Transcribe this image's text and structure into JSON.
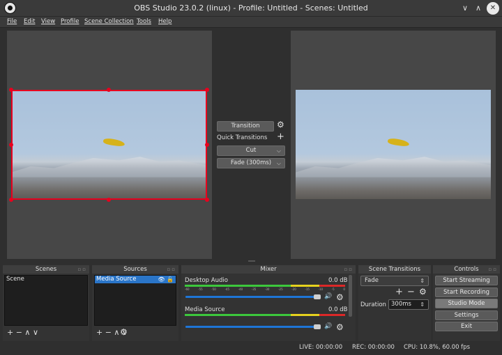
{
  "window": {
    "title": "OBS Studio 23.0.2 (linux) - Profile: Untitled - Scenes: Untitled",
    "min_glyph": "∨",
    "max_glyph": "∧",
    "close_glyph": "✕"
  },
  "menu": [
    "File",
    "Edit",
    "View",
    "Profile",
    "Scene Collection",
    "Tools",
    "Help"
  ],
  "transition": {
    "button_label": "Transition",
    "quick_label": "Quick Transitions",
    "quick_add": "+",
    "cut": "Cut",
    "fade": "Fade (300ms)"
  },
  "docks": {
    "scenes": {
      "title": "Scenes",
      "items": [
        "Scene"
      ],
      "toolbar": "+  −    ∧  ∨"
    },
    "sources": {
      "title": "Sources",
      "items": [
        "Media Source"
      ],
      "toolbar": "+  −    ∧  ∨"
    },
    "mixer": {
      "title": "Mixer",
      "tracks": [
        {
          "name": "Desktop Audio",
          "level": "0.0 dB",
          "volume": 0.86
        },
        {
          "name": "Media Source",
          "level": "0.0 dB",
          "volume": 0.86
        }
      ],
      "ticks": [
        "-60",
        "-55",
        "-50",
        "-45",
        "-40",
        "-35",
        "-30",
        "-25",
        "-20",
        "-15",
        "-10",
        "-5",
        "0"
      ]
    },
    "transitions": {
      "title": "Scene Transitions",
      "selected": "Fade",
      "add": "+",
      "remove": "−",
      "duration_label": "Duration",
      "duration_value": "300ms"
    },
    "controls": {
      "title": "Controls",
      "buttons": [
        "Start Streaming",
        "Start Recording",
        "Studio Mode",
        "Settings",
        "Exit"
      ]
    }
  },
  "status": {
    "live": "LIVE: 00:00:00",
    "rec": "REC: 00:00:00",
    "cpu": "CPU: 10.8%, 60.00 fps"
  },
  "colors": {
    "accent": "#2a75c8",
    "selection": "#e8001e",
    "meter_green": "#3cc83c",
    "meter_yellow": "#e6d21e",
    "meter_red": "#dc2828"
  }
}
